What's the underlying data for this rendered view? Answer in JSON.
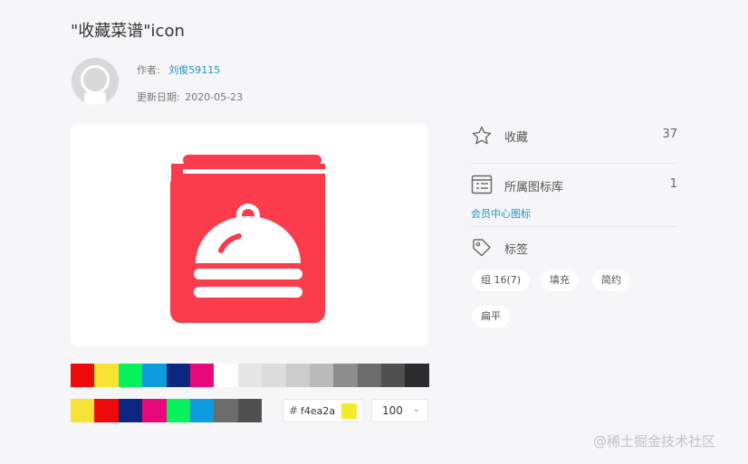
{
  "page": {
    "title": "\"收藏菜谱\"icon"
  },
  "author": {
    "label": "作者:",
    "name": "刘俊59115"
  },
  "updated": {
    "label": "更新日期:",
    "date": "2020-05-23"
  },
  "palette_row1": [
    "#ee0a0a",
    "#f7e333",
    "#06f25a",
    "#0f9cde",
    "#0c2780",
    "#e8087a",
    "#ffffff",
    "#e6e6e6",
    "#dcdcdc",
    "#cccccc",
    "#bbbbbb",
    "#8e8e8e",
    "#6c6c6c",
    "#505050",
    "#2c2c2e"
  ],
  "palette_row2": [
    "#f7e333",
    "#ee0a0a",
    "#0c2780",
    "#e8087a",
    "#06f25a",
    "#0f9cde",
    "#6c6c6c",
    "#505050"
  ],
  "color_input": {
    "hash": "#",
    "value": "f4ea2a",
    "chip_color": "#f4ea2a"
  },
  "size_select": {
    "value": "100",
    "chevron": "⌄"
  },
  "icon_colors": {
    "primary": "#fa3c4c",
    "accent": "#ffffff"
  },
  "sidebar": {
    "favorite": {
      "icon": "star-icon",
      "label": "收藏",
      "count": "37"
    },
    "library": {
      "icon": "list-icon",
      "label": "所属图标库",
      "count": "1"
    },
    "member_link": "会员中心图标",
    "tags_header": {
      "icon": "tag-icon",
      "label": "标签"
    },
    "tags": [
      "组 16(7)",
      "填充",
      "简约",
      "扁平"
    ]
  },
  "watermark": "@稀土掘金技术社区"
}
